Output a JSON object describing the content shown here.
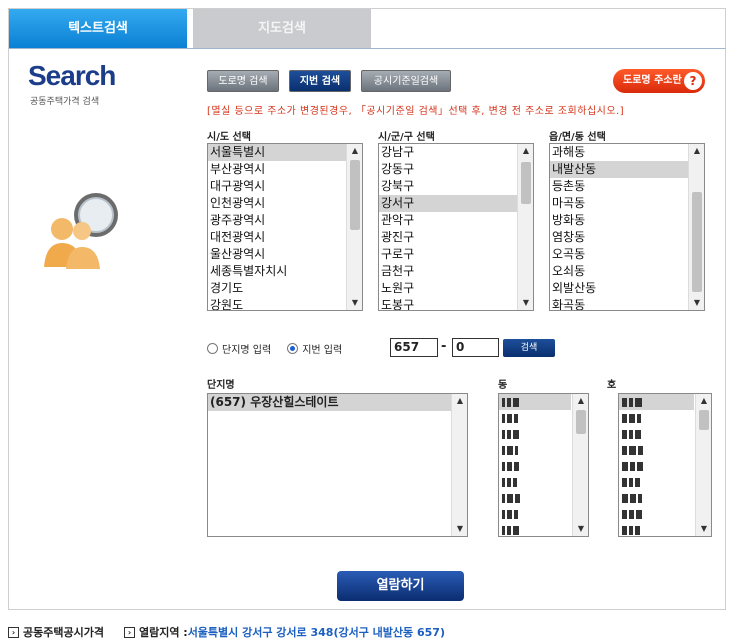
{
  "tabs": {
    "text_search": "텍스트검색",
    "map_search": "지도검색"
  },
  "logo": {
    "word": "Search",
    "sub": "공동주택가격 검색"
  },
  "buttons": {
    "road_search": "도로명 검색",
    "lot_search": "지번 검색",
    "date_search": "공시기준일검색",
    "road_help": "도로명 주소란",
    "search": "검색",
    "view": "열람하기"
  },
  "notice": "[멸실 등으로 주소가 변경된경우, 「공시기준일 검색」선택 후, 변경 전 주소로 조회하십시오.]",
  "region": {
    "sido_title": "시/도 선택",
    "sigungu_title": "시/군/구 선택",
    "dong_title": "읍/면/동 선택",
    "sido": [
      "서울특별시",
      "부산광역시",
      "대구광역시",
      "인천광역시",
      "광주광역시",
      "대전광역시",
      "울산광역시",
      "세종특별자치시",
      "경기도",
      "강원도"
    ],
    "sigungu": [
      "강남구",
      "강동구",
      "강북구",
      "강서구",
      "관악구",
      "광진구",
      "구로구",
      "금천구",
      "노원구",
      "도봉구"
    ],
    "dong": [
      "과해동",
      "내발산동",
      "등촌동",
      "마곡동",
      "방화동",
      "염창동",
      "오곡동",
      "오쇠동",
      "외발산동",
      "화곡동"
    ]
  },
  "input": {
    "radio_complex": "단지명 입력",
    "radio_lot": "지번 입력",
    "lot_main": "657",
    "lot_sub": "0"
  },
  "results": {
    "complex_title": "단지명",
    "dong_title": "동",
    "ho_title": "호",
    "complex_items": [
      "(657) 우장산힐스테이트"
    ]
  },
  "footer": {
    "label": "공동주택공시가격",
    "area_label": "열람지역 : ",
    "area_value": "서울특별시 강서구 강서로 348(강서구 내발산동 657)"
  },
  "colors": {
    "tab_active": "#0a7fd3",
    "brand_navy": "#0b2d70",
    "notice_red": "#d4331a",
    "help_red": "#d92a0b"
  }
}
